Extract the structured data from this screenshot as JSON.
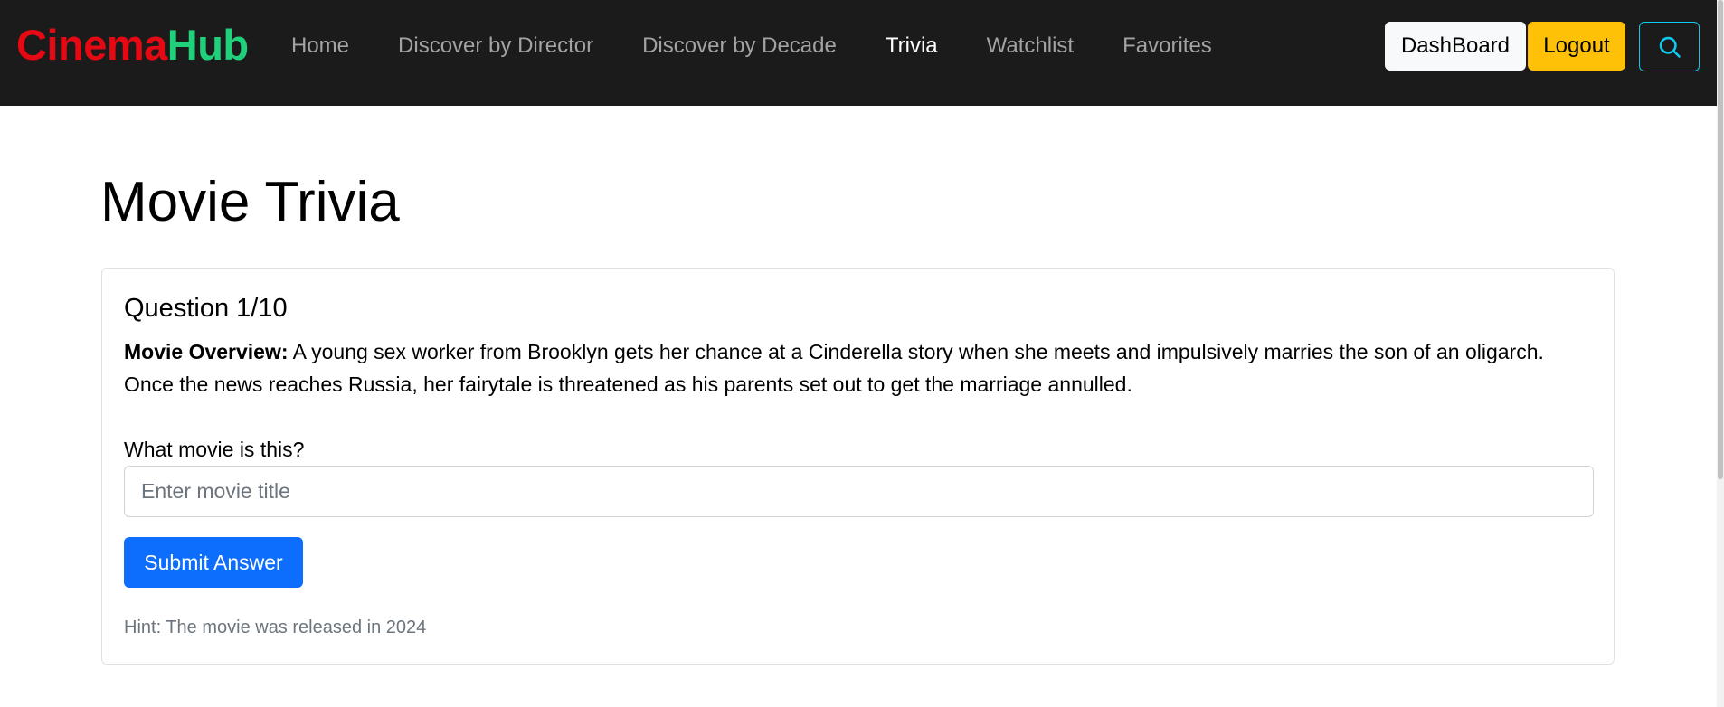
{
  "navbar": {
    "brand": {
      "part1": "Cinema",
      "part2": "Hub"
    },
    "links": [
      {
        "label": "Home",
        "active": false
      },
      {
        "label": "Discover by Director",
        "active": false
      },
      {
        "label": "Discover by Decade",
        "active": false
      },
      {
        "label": "Trivia",
        "active": true
      },
      {
        "label": "Watchlist",
        "active": false
      },
      {
        "label": "Favorites",
        "active": false
      }
    ],
    "dashboard_label": "DashBoard",
    "logout_label": "Logout",
    "search_icon": "search-icon"
  },
  "page": {
    "title": "Movie Trivia"
  },
  "trivia": {
    "question_label": "Question 1/10",
    "overview_label": "Movie Overview:",
    "overview_text": " A young sex worker from Brooklyn gets her chance at a Cinderella story when she meets and impulsively marries the son of an oligarch. Once the news reaches Russia, her fairytale is threatened as his parents set out to get the marriage annulled.",
    "prompt": "What movie is this?",
    "input_value": "",
    "input_placeholder": "Enter movie title",
    "submit_label": "Submit Answer",
    "hint": "Hint: The movie was released in 2024"
  },
  "colors": {
    "navbar_bg": "#1b1b1b",
    "brand_primary": "#e50914",
    "brand_secondary": "#21d07a",
    "logout_bg": "#ffc107",
    "search_border": "#0dcaf0",
    "submit_bg": "#0d6efd"
  }
}
